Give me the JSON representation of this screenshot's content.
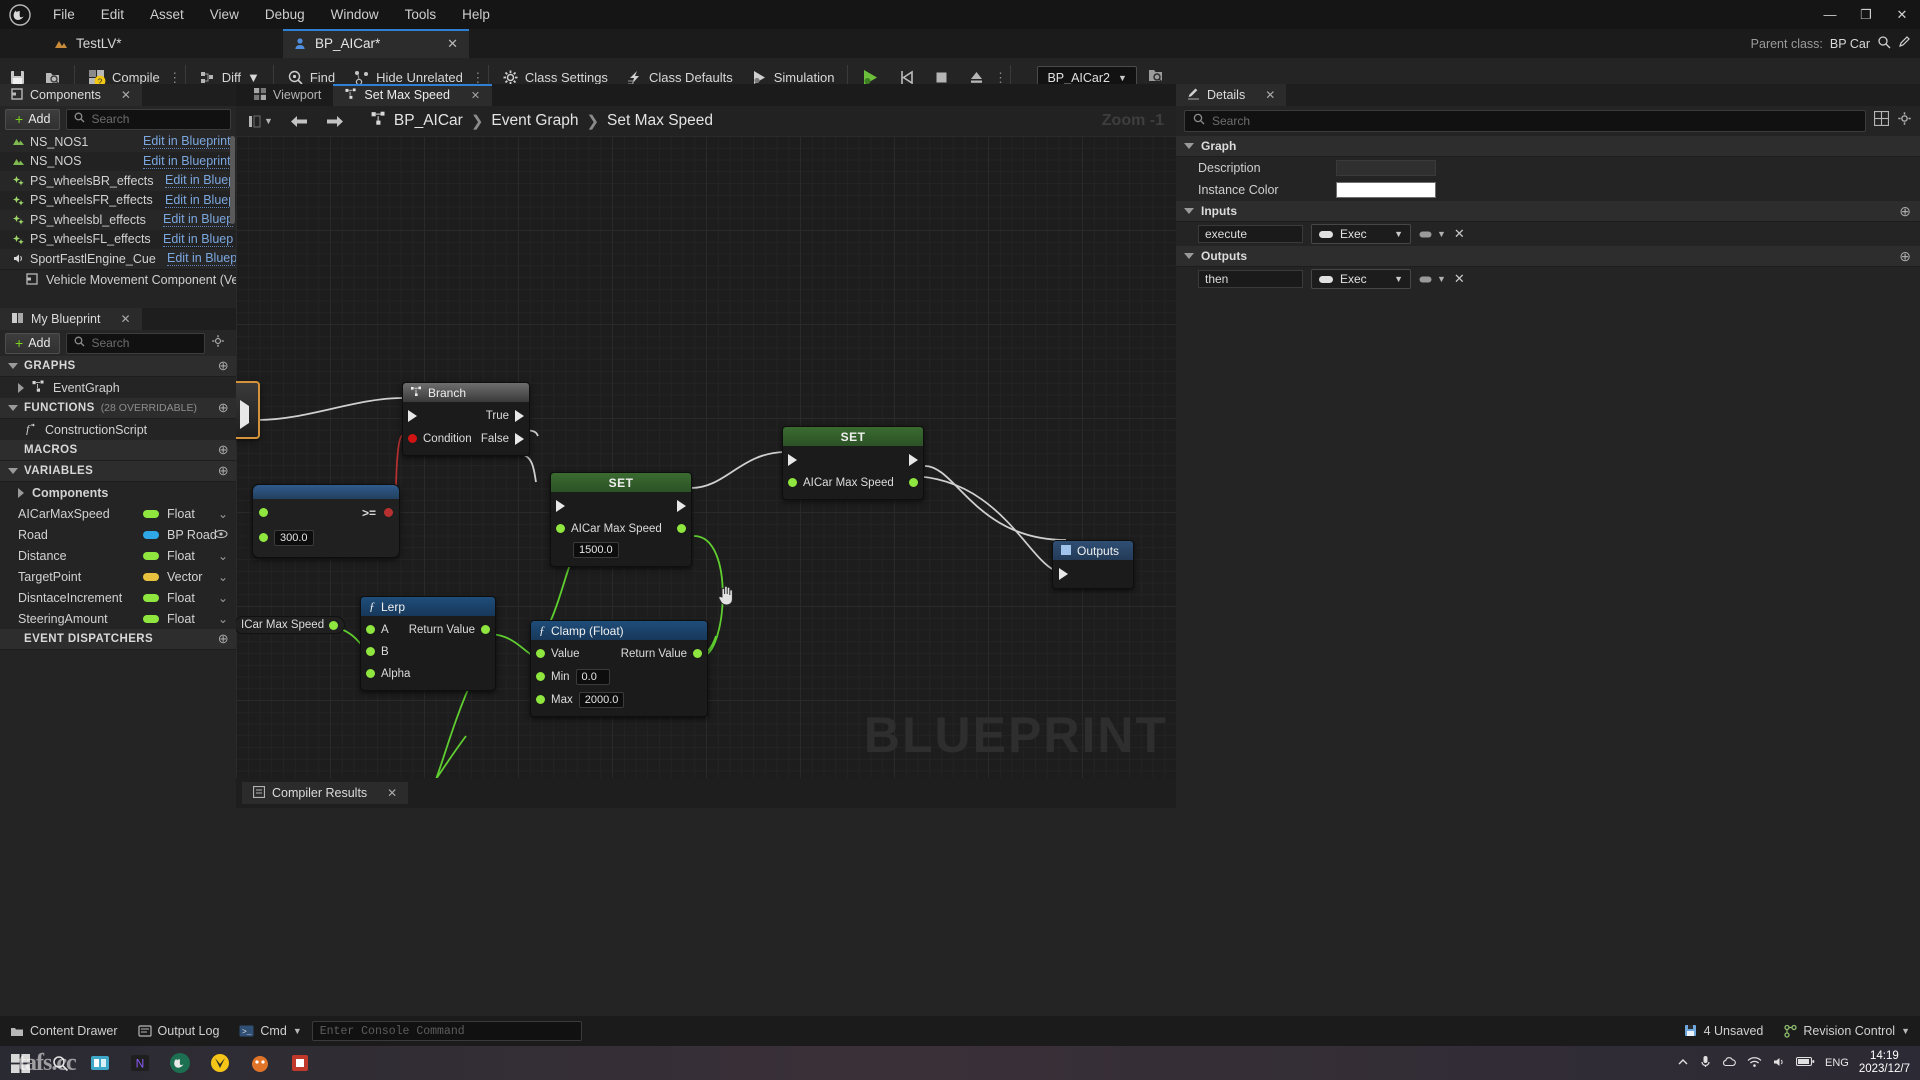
{
  "app": {
    "menu": [
      "File",
      "Edit",
      "Asset",
      "View",
      "Debug",
      "Window",
      "Tools",
      "Help"
    ],
    "window_buttons": {
      "minimize": "—",
      "maximize": "❐",
      "close": "✕"
    }
  },
  "tabs": {
    "level_tab": "TestLV*",
    "blueprint_tab": "BP_AICar*",
    "blueprint_tab_close": "✕",
    "parent_class_label": "Parent class:",
    "parent_class_value": "BP Car"
  },
  "toolbar": {
    "save_icon": "save-icon",
    "browse_icon": "browse-icon",
    "compile": "Compile",
    "diff": "Diff",
    "find": "Find",
    "hide_unrelated": "Hide Unrelated",
    "class_settings": "Class Settings",
    "class_defaults": "Class Defaults",
    "simulation": "Simulation",
    "play": "play-icon",
    "step": "step-icon",
    "stop": "stop-icon",
    "eject": "eject-icon",
    "debug_object": "BP_AICar2"
  },
  "components_panel": {
    "title": "Components",
    "close": "✕",
    "add_label": "Add",
    "search_placeholder": "Search",
    "edit_label": "Edit in Blueprint",
    "items": [
      {
        "name": "NS_NOS1",
        "icon": "niagara-icon",
        "edit": "Edit in Blueprint"
      },
      {
        "name": "NS_NOS",
        "icon": "niagara-icon",
        "edit": "Edit in Blueprint"
      },
      {
        "name": "PS_wheelsBR_effects",
        "icon": "particle-icon",
        "edit": "Edit in Bluep"
      },
      {
        "name": "PS_wheelsFR_effects",
        "icon": "particle-icon",
        "edit": "Edit in Bluep"
      },
      {
        "name": "PS_wheelsbl_effects",
        "icon": "particle-icon",
        "edit": "Edit in Bluep"
      },
      {
        "name": "PS_wheelsFL_effects",
        "icon": "particle-icon",
        "edit": "Edit in Bluep"
      },
      {
        "name": "SportFastlEngine_Cue",
        "icon": "audio-icon",
        "edit": "Edit in Bluep"
      }
    ],
    "footer_item": "Vehicle Movement Component (Vehic"
  },
  "my_blueprint": {
    "title": "My Blueprint",
    "close": "✕",
    "add_label": "Add",
    "search_placeholder": "Search",
    "sections": {
      "graphs": {
        "label": "GRAPHS",
        "items": [
          {
            "label": "EventGraph",
            "icon": "graph-icon"
          }
        ]
      },
      "functions": {
        "label": "FUNCTIONS",
        "sub": "(28 OVERRIDABLE)",
        "items": [
          {
            "label": "ConstructionScript",
            "icon": "function-icon"
          }
        ]
      },
      "macros": {
        "label": "MACROS",
        "items": []
      },
      "variables": {
        "label": "VARIABLES",
        "group": "Components",
        "items": [
          {
            "name": "AICarMaxSpeed",
            "type": "Float",
            "color": "#8ee63f"
          },
          {
            "name": "Road",
            "type": "BP Road",
            "color": "#2fa8e8"
          },
          {
            "name": "Distance",
            "type": "Float",
            "color": "#8ee63f"
          },
          {
            "name": "TargetPoint",
            "type": "Vector",
            "color": "#e8c23f"
          },
          {
            "name": "DisntaceIncrement",
            "type": "Float",
            "color": "#8ee63f"
          },
          {
            "name": "SteeringAmount",
            "type": "Float",
            "color": "#8ee63f"
          }
        ]
      },
      "event_dispatchers": {
        "label": "EVENT DISPATCHERS"
      }
    }
  },
  "graph": {
    "tabs": [
      {
        "label": "Viewport",
        "icon": "viewport-icon",
        "active": false
      },
      {
        "label": "Set Max Speed",
        "icon": "graph-icon",
        "active": true,
        "close": "✕"
      }
    ],
    "breadcrumb": [
      "BP_AICar",
      "Event Graph",
      "Set Max Speed"
    ],
    "breadcrumb_sep": "❯",
    "zoom_label": "Zoom -1",
    "watermark": "BLUEPRINT",
    "nodes": [
      {
        "id": "branch",
        "title": "Branch",
        "kind": "branch",
        "inputs": [
          {
            "label": "",
            "type": "exec"
          },
          {
            "label": "Condition",
            "type": "bool"
          }
        ],
        "outputs": [
          {
            "label": "True",
            "type": "exec"
          },
          {
            "label": "False",
            "type": "exec"
          }
        ]
      },
      {
        "id": "compare",
        "title": ">=",
        "kind": "pure",
        "value": "300.0"
      },
      {
        "id": "set1",
        "title": "SET",
        "kind": "set",
        "pin_label": "AICar Max Speed",
        "value": "1500.0"
      },
      {
        "id": "set2",
        "title": "SET",
        "kind": "set",
        "pin_label": "AICar Max Speed",
        "value": ""
      },
      {
        "id": "lerp",
        "title": "Lerp",
        "kind": "function",
        "inputs": [
          {
            "label": "A"
          },
          {
            "label": "B"
          },
          {
            "label": "Alpha"
          }
        ],
        "outputs": [
          {
            "label": "Return Value"
          }
        ]
      },
      {
        "id": "clamp",
        "title": "Clamp (Float)",
        "kind": "function",
        "inputs": [
          {
            "label": "Value"
          },
          {
            "label": "Min",
            "value": "0.0"
          },
          {
            "label": "Max",
            "value": "2000.0"
          }
        ],
        "outputs": [
          {
            "label": "Return Value"
          }
        ]
      },
      {
        "id": "outputs",
        "title": "Outputs",
        "kind": "outputs"
      }
    ],
    "free_labels": [
      "ICar Max Speed"
    ]
  },
  "compiler_results": {
    "title": "Compiler Results",
    "close": "✕",
    "icon": "compiler-icon"
  },
  "details": {
    "title": "Details",
    "close": "✕",
    "search_placeholder": "Search",
    "grid_icon": "grid-icon",
    "settings_icon": "gear-icon",
    "sections": [
      {
        "label": "Graph",
        "rows": [
          {
            "label": "Description",
            "control": "dark"
          },
          {
            "label": "Instance Color",
            "control": "white"
          }
        ]
      },
      {
        "label": "Inputs",
        "has_add": true,
        "io": [
          {
            "name": "execute",
            "type": "Exec",
            "remove": "✕"
          }
        ]
      },
      {
        "label": "Outputs",
        "has_add": true,
        "io": [
          {
            "name": "then",
            "type": "Exec",
            "remove": "✕"
          }
        ]
      }
    ]
  },
  "status_bar": {
    "content_drawer": "Content Drawer",
    "output_log": "Output Log",
    "cmd": "Cmd",
    "console_placeholder": "Enter Console Command",
    "unsaved": "4 Unsaved",
    "revision_control": "Revision Control"
  },
  "taskbar": {
    "watermark": "tafs.cc",
    "language": "ENG",
    "time": "14:19",
    "date": "2023/12/7"
  },
  "colors": {
    "exec_white": "#e8e8e8",
    "float_green": "#8ee63f",
    "bool_red": "#d01414",
    "object_blue": "#2fa8e8",
    "accent_blue": "#2f7fd4",
    "set_green": "#3a6b30"
  }
}
